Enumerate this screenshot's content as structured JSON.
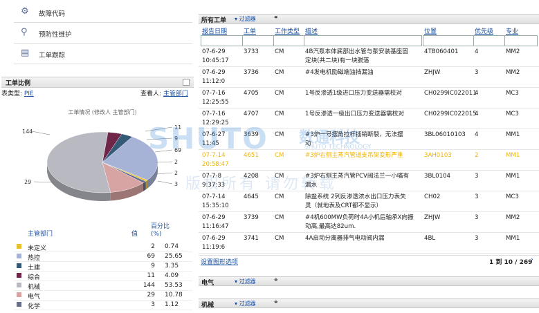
{
  "nav": {
    "items": [
      {
        "label": "故障代码",
        "icon": "fault-code-icon"
      },
      {
        "label": "预防性维护",
        "icon": "maintenance-icon"
      },
      {
        "label": "工单跟踪",
        "icon": "tracking-icon"
      }
    ]
  },
  "workorder_ratio": {
    "title": "工单比例",
    "type_label": "表类型:",
    "type_value": "PIE",
    "viewer_label": "查看人:",
    "viewer_value": "主管部门",
    "legend_headers": {
      "dept": "主管部门",
      "value": "值",
      "percent": "百分比(%)"
    }
  },
  "chart_data": {
    "type": "pie",
    "title": "工单情况 (修改人 主管部门)",
    "categories": [
      "未定义",
      "热控",
      "土建",
      "综合",
      "机械",
      "电气",
      "化学"
    ],
    "values": [
      2,
      69,
      9,
      11,
      144,
      29,
      3
    ],
    "percents": [
      "0.74",
      "25.65",
      "3.35",
      "4.09",
      "53.53",
      "10.78",
      "1.12"
    ],
    "colors": [
      "#e8c02e",
      "#a6b2d6",
      "#355a78",
      "#6e2548",
      "#b9b9c2",
      "#d8a3a3",
      "#6a6f8c"
    ],
    "outer_labels": [
      "144",
      "11",
      "9",
      "69",
      "2",
      "2",
      "3",
      "29"
    ]
  },
  "workorders": {
    "title": "所有工单",
    "filter_label": "过滤器",
    "columns": [
      "报告日期",
      "工单",
      "工作类型",
      "描述",
      "位置",
      "优先级",
      "专业"
    ],
    "rows": [
      {
        "date": "07-6-29",
        "time": "10:45:17",
        "id": "3733",
        "type": "CM",
        "desc1": "4B汽泵本体底部出水管与泵安装基座固",
        "desc2": "定块(共二块)有一块脱落",
        "loc": "4TB060401",
        "pri": "4",
        "spec": "MM2"
      },
      {
        "date": "07-6-29",
        "time": "11:12:0",
        "id": "3736",
        "type": "CM",
        "desc1": "#4发电机励磁端油挡漏油",
        "desc2": "",
        "loc": "ZHJW",
        "pri": "3",
        "spec": "MM2"
      },
      {
        "date": "07-7-16",
        "time": "12:25:55",
        "id": "4705",
        "type": "CM",
        "desc1": "1号反渗透1级进口压力变送器需校对",
        "desc2": "",
        "loc": "CH0299IC022011",
        "pri": "4",
        "spec": "MC3"
      },
      {
        "date": "07-7-16",
        "time": "12:29:25",
        "id": "4707",
        "type": "CM",
        "desc1": "1号反渗透一级出口压力变送器需校对",
        "desc2": "",
        "loc": "CH0299IC022015",
        "pri": "4",
        "spec": "MC3"
      },
      {
        "date": "07-6-27",
        "time": "11:45",
        "id": "3639",
        "type": "CM",
        "desc1": "#3炉一号摆角拉杆插销断裂，无法摆",
        "desc2": "动",
        "loc": "3BL06010103",
        "pri": "4",
        "spec": "MM1"
      },
      {
        "date": "07-7-14",
        "time": "20:58:47",
        "id": "4651",
        "type": "CM",
        "desc1": "#3炉右侧主蒸汽管道支吊架变形严重",
        "desc2": "",
        "loc": "3AH0103",
        "pri": "2",
        "spec": "MM1",
        "highlight": true
      },
      {
        "date": "07-7-8",
        "time": "9:37:33",
        "id": "4208",
        "type": "CM",
        "desc1": "#3炉右侧主蒸汽管PCV阀法兰一小嘴有",
        "desc2": "漏水",
        "loc": "3BL0104",
        "pri": "3",
        "spec": "MM1"
      },
      {
        "date": "07-7-14",
        "time": "15:35:10",
        "id": "4645",
        "type": "CM",
        "desc1": "除盐系统 2列反渗透浓水出口压力表失",
        "desc2": "灵（就地表及CRT都不显示）",
        "loc": "CH02",
        "pri": "3",
        "spec": "MC3"
      },
      {
        "date": "07-6-29",
        "time": "11:16:47",
        "id": "3739",
        "type": "CM",
        "desc1": "#4机600MW负荷时4A小机后轴承X向振",
        "desc2": "动高,最高达82um.",
        "loc": "ZHJW",
        "pri": "3",
        "spec": "MM2"
      },
      {
        "date": "07-6-29",
        "time": "11:19:6",
        "id": "3741",
        "type": "CM",
        "desc1": "4A启动分离器排气电动阀内漏",
        "desc2": "",
        "loc": "4BL",
        "pri": "3",
        "spec": "MM1"
      }
    ],
    "settings_link": "设置图形选项",
    "pager": "1 到 10 / 269"
  },
  "sections": [
    {
      "title": "电气",
      "filter_label": "过滤器"
    },
    {
      "title": "机械",
      "filter_label": "过滤器"
    }
  ],
  "watermark": {
    "brand": "SHUTO",
    "cn": "数通科技",
    "en": "SHUTO TECHNOLOGY",
    "copy": "版权所有 请勿转载"
  }
}
